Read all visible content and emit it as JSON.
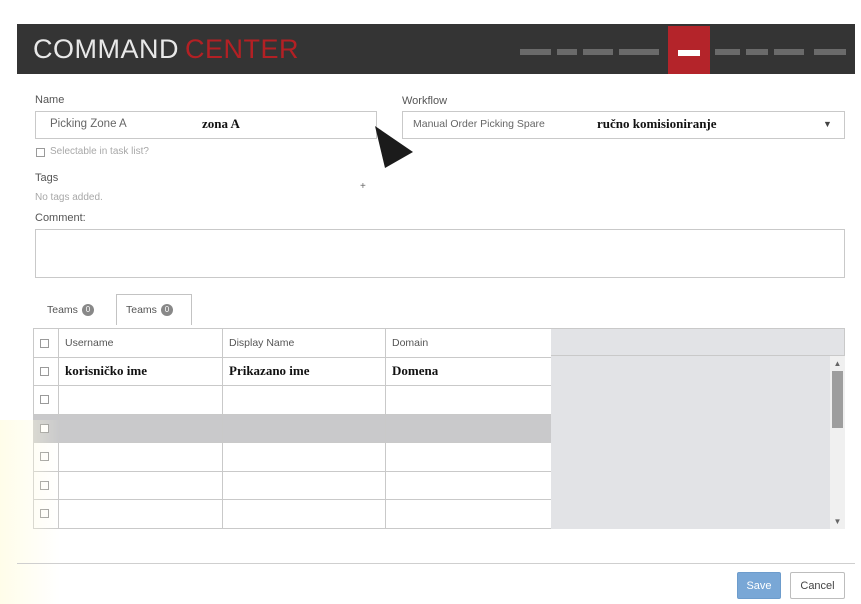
{
  "header": {
    "logo_part1": "COMMAND",
    "logo_part2": "CENTER",
    "accent_color": "#b4242a",
    "bg_color": "#343434"
  },
  "form": {
    "name_label": "Name",
    "name_value": "Picking Zone A",
    "name_annotation": "zona A",
    "selectable_label": "Selectable in task list?",
    "workflow_label": "Workflow",
    "workflow_value": "Manual Order Picking Spare",
    "workflow_annotation": "ručno komisioniranje",
    "tags_label": "Tags",
    "tags_empty": "No tags added.",
    "add_tag_symbol": "+",
    "comment_label": "Comment:"
  },
  "tabs": [
    {
      "label": "Teams",
      "count": "0"
    },
    {
      "label": "Teams",
      "count": "0"
    }
  ],
  "table": {
    "columns": [
      "Username",
      "Display Name",
      "Domain"
    ],
    "first_row": [
      "korisničko ime",
      "Prikazano ime",
      "Domena"
    ]
  },
  "footer": {
    "save_label": "Save",
    "cancel_label": "Cancel"
  },
  "icons": {
    "pointer": "cursor-arrow-icon",
    "dropdown": "caret-down-icon"
  }
}
